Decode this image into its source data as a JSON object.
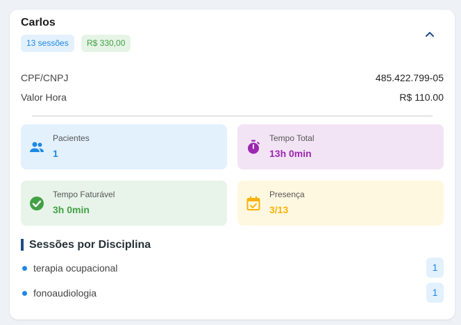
{
  "client": {
    "name": "Carlos",
    "sessions_chip": "13 sessões",
    "amount_chip": "R$ 330,00"
  },
  "details": [
    {
      "label": "CPF/CNPJ",
      "value": "485.422.799-05"
    },
    {
      "label": "Valor Hora",
      "value": "R$ 110.00"
    }
  ],
  "stats": {
    "patients": {
      "label": "Pacientes",
      "value": "1",
      "icon": "people-icon",
      "color": "#1e88e5"
    },
    "total_time": {
      "label": "Tempo Total",
      "value": "13h 0min",
      "icon": "timer-icon",
      "color": "#9c27b0"
    },
    "billable_time": {
      "label": "Tempo Faturável",
      "value": "3h 0min",
      "icon": "check-circle-icon",
      "color": "#43a047"
    },
    "attendance": {
      "label": "Presença",
      "value": "3/13",
      "icon": "calendar-check-icon",
      "color": "#f9b208"
    }
  },
  "disciplines": {
    "title": "Sessões por Disciplina",
    "items": [
      {
        "label": "terapia ocupacional",
        "count": "1"
      },
      {
        "label": "fonoaudiologia",
        "count": "1"
      }
    ]
  },
  "colors": {
    "accent_blue": "#1e88e5",
    "accent_green": "#43a047",
    "accent_purple": "#9c27b0",
    "accent_yellow": "#f9b208",
    "section_bar": "#1e4b86"
  }
}
